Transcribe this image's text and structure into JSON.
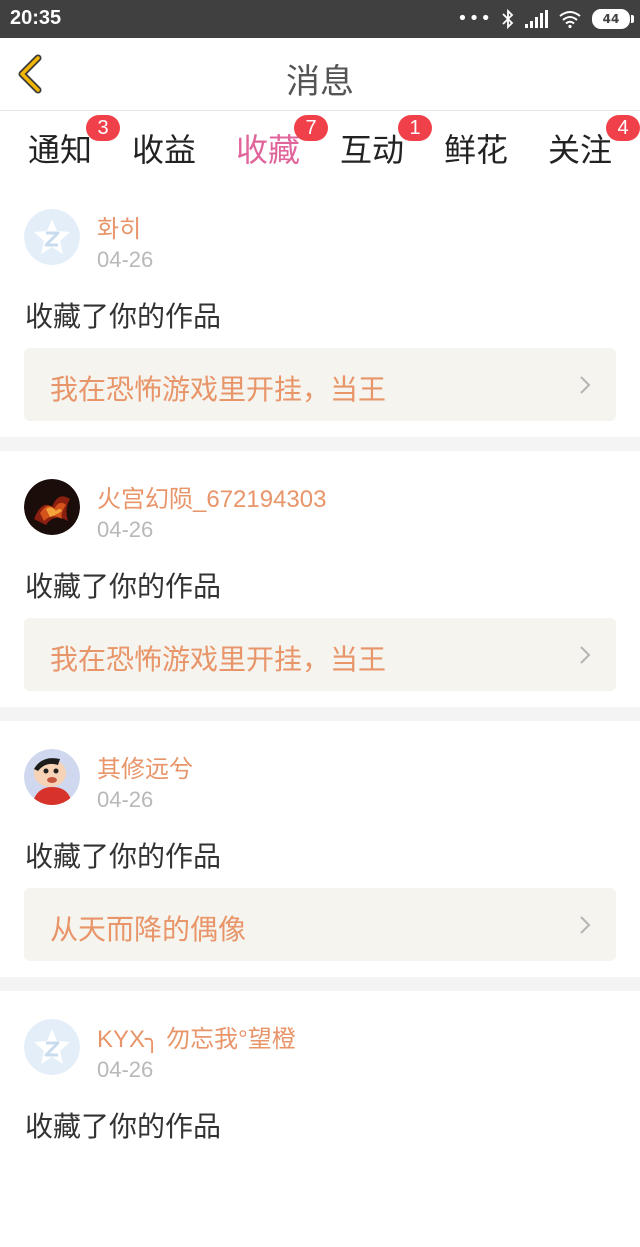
{
  "status_bar": {
    "time": "20:35",
    "battery": "44",
    "dots": "•••"
  },
  "header": {
    "title": "消息"
  },
  "tabs": [
    {
      "label": "通知",
      "badge": "3",
      "active": false
    },
    {
      "label": "收益",
      "badge": "",
      "active": false
    },
    {
      "label": "收藏",
      "badge": "7",
      "active": true
    },
    {
      "label": "互动",
      "badge": "1",
      "active": false
    },
    {
      "label": "鲜花",
      "badge": "",
      "active": false
    },
    {
      "label": "关注",
      "badge": "4",
      "active": false
    }
  ],
  "feed": [
    {
      "username": "화히",
      "date": "04-26",
      "action": "收藏了你的作品",
      "work_title": "我在恐怖游戏里开挂，当王",
      "avatar": "default-avatar-icon"
    },
    {
      "username": "火宫幻陨_672194303",
      "date": "04-26",
      "action": "收藏了你的作品",
      "work_title": "我在恐怖游戏里开挂，当王",
      "avatar": "user-photo-fire"
    },
    {
      "username": "其修远兮",
      "date": "04-26",
      "action": "收藏了你的作品",
      "work_title": "从天而降的偶像",
      "avatar": "user-photo-cartoon"
    },
    {
      "username": "KYX╮ 勿忘我°望橙",
      "date": "04-26",
      "action": "收藏了你的作品",
      "work_title": "",
      "avatar": "default-avatar-icon"
    }
  ],
  "colors": {
    "accent": "#e0659b",
    "badge": "#f0414a",
    "name": "#e8956a",
    "back_arrow": "#f2b705"
  }
}
